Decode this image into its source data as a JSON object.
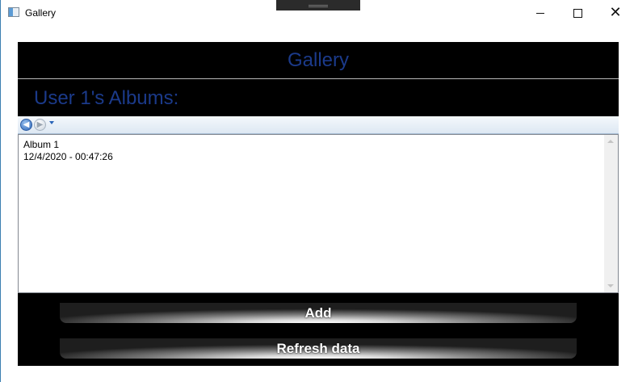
{
  "window": {
    "title": "Gallery",
    "icon": "app-window-icon"
  },
  "header": {
    "title": "Gallery"
  },
  "subheader": {
    "title": "User 1's Albums:"
  },
  "navigation": {
    "back_icon": "back-arrow-icon",
    "forward_icon": "forward-arrow-icon",
    "dropdown_icon": "chevron-down-icon"
  },
  "albums": [
    {
      "name": "Album 1",
      "date": "12/4/2020 - 00:47:26"
    }
  ],
  "buttons": {
    "add_label": "Add",
    "refresh_label": "Refresh data"
  },
  "colors": {
    "background": "#000000",
    "heading": "#1b3a8a"
  }
}
